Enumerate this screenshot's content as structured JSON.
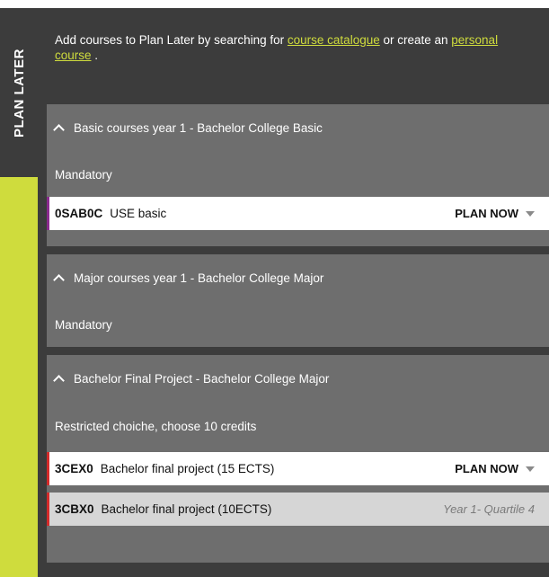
{
  "sidebar": {
    "tab_label": "PLAN LATER"
  },
  "intro": {
    "prefix": "Add courses to Plan Later by searching for ",
    "link1": "course catalogue",
    "middle": " or create an ",
    "link2": "personal course",
    "suffix": " ."
  },
  "groups": [
    {
      "title": "Basic courses year 1 - Bachelor College Basic",
      "subtitle": "Mandatory",
      "courses": [
        {
          "code": "0SAB0C",
          "name": "USE basic",
          "action": "PLAN NOW",
          "bar_color": "#8a2a8e"
        }
      ]
    },
    {
      "title": "Major courses year 1 - Bachelor College Major",
      "subtitle": "Mandatory",
      "courses": []
    },
    {
      "title": "Bachelor Final Project - Bachelor College Major",
      "subtitle": "Restricted choiche, choose 10 credits",
      "courses": [
        {
          "code": "3CEX0",
          "name": "Bachelor final project (15 ECTS)",
          "action": "PLAN NOW",
          "bar_color": "#d42a2a"
        },
        {
          "code": "3CBX0",
          "name": "Bachelor final project (10ECTS)",
          "status": "Year 1- Quartile 4",
          "bar_color": "#d42a2a"
        }
      ]
    }
  ],
  "colors": {
    "accent": "#cfdc3d",
    "panel_bg": "#3c3c3c",
    "group_bg": "#6e6e6e"
  }
}
